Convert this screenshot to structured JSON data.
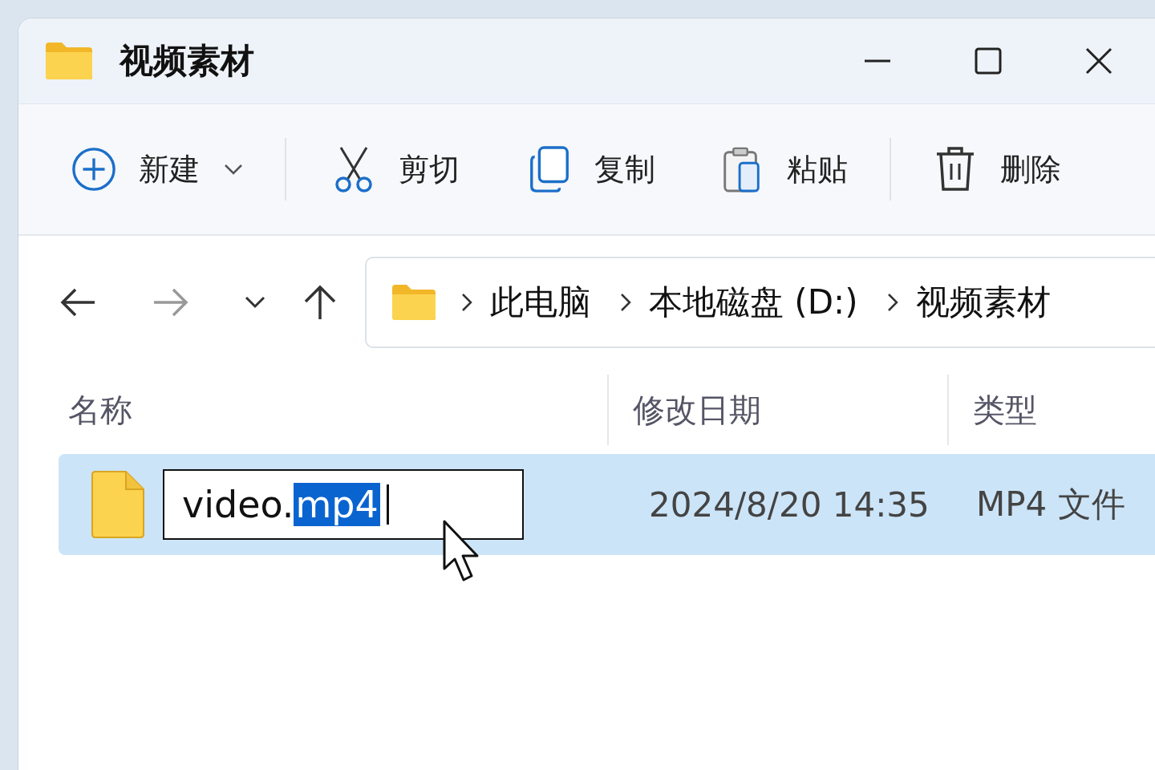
{
  "window": {
    "title": "视频素材"
  },
  "toolbar": [
    {
      "kind": "new",
      "label": "新建"
    },
    {
      "kind": "cut",
      "label": "剪切"
    },
    {
      "kind": "copy",
      "label": "复制"
    },
    {
      "kind": "paste",
      "label": "粘贴"
    },
    {
      "kind": "delete",
      "label": "删除"
    }
  ],
  "navigation": {
    "back_disabled": false,
    "forward_disabled": true
  },
  "breadcrumb": [
    "此电脑",
    "本地磁盘 (D:)",
    "视频素材"
  ],
  "columns": [
    "名称",
    "修改日期",
    "类型"
  ],
  "rows": [
    {
      "selected": true,
      "renaming": true,
      "name": "video.",
      "name_selection": "mp4",
      "date": "2024/8/20 14:35",
      "type": "MP4 文件"
    }
  ]
}
